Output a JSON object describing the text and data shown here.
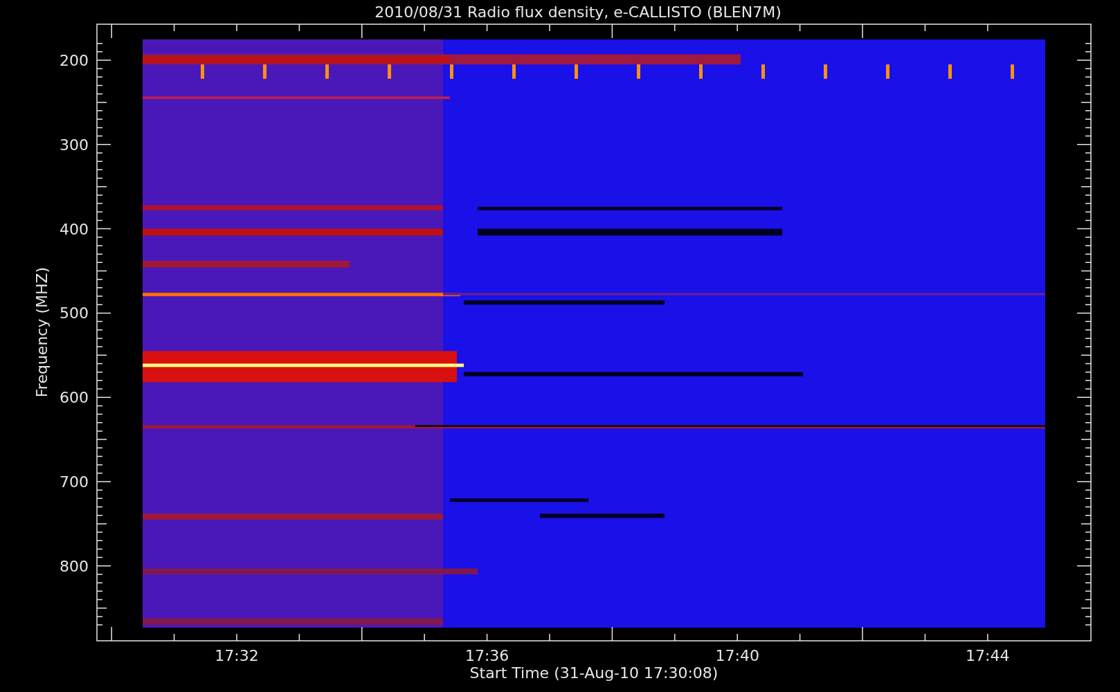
{
  "title": "2010/08/31  Radio flux density, e-CALLISTO (BLEN7M)",
  "y_axis": {
    "label": "Frequency (MHZ)",
    "ticks": [
      "200",
      "300",
      "400",
      "500",
      "600",
      "700",
      "800"
    ]
  },
  "x_axis": {
    "label": "Start Time (31-Aug-10 17:30:08)",
    "ticks": [
      "17:32",
      "17:36",
      "17:40",
      "17:44"
    ]
  }
}
